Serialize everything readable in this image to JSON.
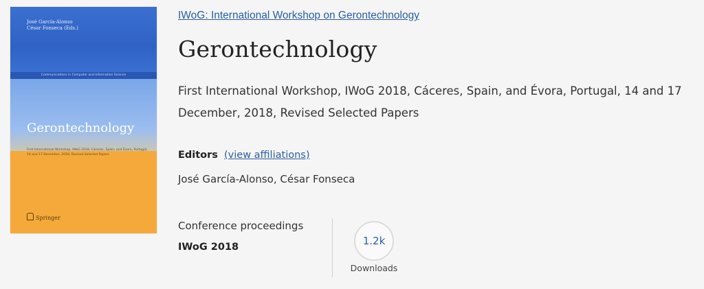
{
  "cover": {
    "authors": [
      "José García-Alonso",
      "César Fonseca (Eds.)"
    ],
    "series": "Communications in Computer and Information Science",
    "title": "Gerontechnology",
    "subtitle": "First International Workshop, IWoG 2018, Cáceres, Spain, and Évora, Portugal, 14 and 17 December, 2018, Revised Selected Papers",
    "publisher": "Springer",
    "colors": {
      "top": "#3b6fd0",
      "middle": "#9bbdf0",
      "bottom": "#f4a93a"
    }
  },
  "workshop_link": "IWoG: International Workshop on Gerontechnology",
  "title": "Gerontechnology",
  "subtitle": "First International Workshop, IWoG 2018, Cáceres, Spain, and Évora, Portugal, 14 and 17 December, 2018, Revised Selected Papers",
  "editors": {
    "label": "Editors",
    "affiliations_link": "(view affiliations)",
    "names": "José  García-Alonso, César Fonseca"
  },
  "proceedings": {
    "type": "Conference proceedings",
    "acronym": "IWoG 2018"
  },
  "downloads": {
    "count": "1.2k",
    "label": "Downloads"
  },
  "colors": {
    "link": "#2a5ea8",
    "background": "#f5f5f5"
  }
}
